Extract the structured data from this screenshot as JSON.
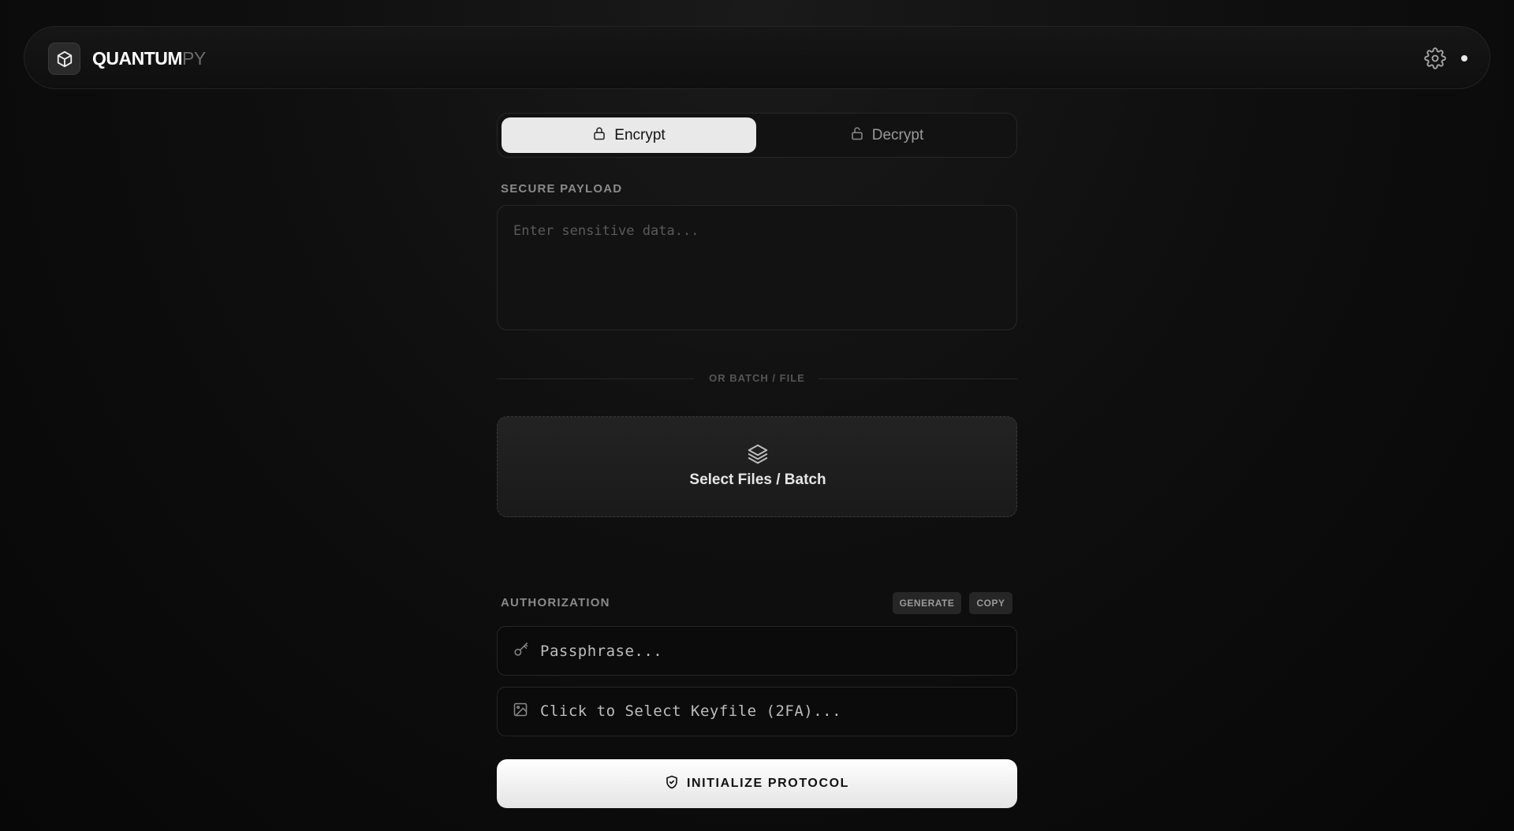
{
  "header": {
    "brand_primary": "QUANTUM",
    "brand_secondary": "PY",
    "logo_icon": "cube-icon",
    "settings_icon": "gear-icon"
  },
  "tabs": [
    {
      "label": "Encrypt",
      "icon": "lock-icon",
      "active": true
    },
    {
      "label": "Decrypt",
      "icon": "unlock-icon",
      "active": false
    }
  ],
  "payload": {
    "label": "SECURE PAYLOAD",
    "placeholder": "Enter sensitive data..."
  },
  "divider": {
    "text": "OR BATCH / FILE"
  },
  "dropzone": {
    "label": "Select Files / Batch",
    "icon": "layers-icon"
  },
  "authorization": {
    "label": "AUTHORIZATION",
    "generate_label": "GENERATE",
    "copy_label": "COPY",
    "passphrase_placeholder": "Passphrase...",
    "passphrase_icon": "key-icon",
    "keyfile_text": "Click to Select Keyfile (2FA)...",
    "keyfile_icon": "image-icon"
  },
  "cta": {
    "label": "INITIALIZE PROTOCOL",
    "icon": "shield-check-icon"
  },
  "colors": {
    "background": "#0f0f0f",
    "surface": "#121212",
    "border": "#262626",
    "active_tab": "#e9e9e9",
    "cta": "#ffffff"
  }
}
